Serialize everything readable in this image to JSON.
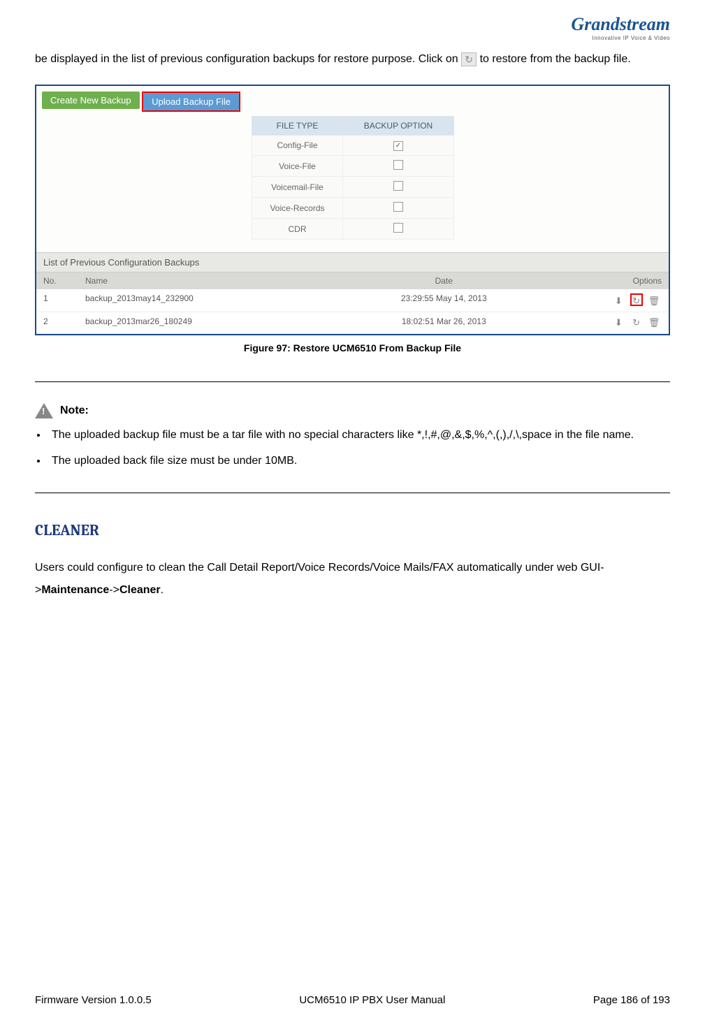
{
  "header": {
    "logo_text": "Grandstream",
    "logo_sub": "Innovative IP Voice & Video"
  },
  "intro": {
    "part1": "be displayed in the list of previous configuration backups for restore purpose. Click on ",
    "part2": " to restore from the backup file."
  },
  "screenshot": {
    "btn_create": "Create New Backup",
    "btn_upload": "Upload Backup File",
    "opts_header_file": "FILE TYPE",
    "opts_header_backup": "BACKUP OPTION",
    "file_types": [
      {
        "label": "Config-File",
        "checked": true
      },
      {
        "label": "Voice-File",
        "checked": false
      },
      {
        "label": "Voicemail-File",
        "checked": false
      },
      {
        "label": "Voice-Records",
        "checked": false
      },
      {
        "label": "CDR",
        "checked": false
      }
    ],
    "section_title": "List of Previous Configuration Backups",
    "cols": {
      "no": "No.",
      "name": "Name",
      "date": "Date",
      "options": "Options"
    },
    "rows": [
      {
        "no": "1",
        "name": "backup_2013may14_232900",
        "date": "23:29:55 May 14, 2013",
        "highlight": true
      },
      {
        "no": "2",
        "name": "backup_2013mar26_180249",
        "date": "18:02:51 Mar 26, 2013",
        "highlight": false
      }
    ]
  },
  "caption": "Figure 97: Restore UCM6510 From Backup File",
  "note": {
    "label": "Note:",
    "items": [
      "The uploaded backup file must be a tar file with no special characters like *,!,#,@,&,$,%,^,(,),/,\\,space in the file name.",
      "The uploaded back file size must be under 10MB."
    ]
  },
  "section_heading": "CLEANER",
  "cleaner_text": {
    "pre": "Users could configure to clean the Call Detail Report/Voice Records/Voice Mails/FAX automatically under web GUI->",
    "b1": "Maintenance",
    "mid": "->",
    "b2": "Cleaner",
    "post": "."
  },
  "footer": {
    "left": "Firmware Version 1.0.0.5",
    "center": "UCM6510 IP PBX User Manual",
    "right": "Page 186 of 193"
  }
}
